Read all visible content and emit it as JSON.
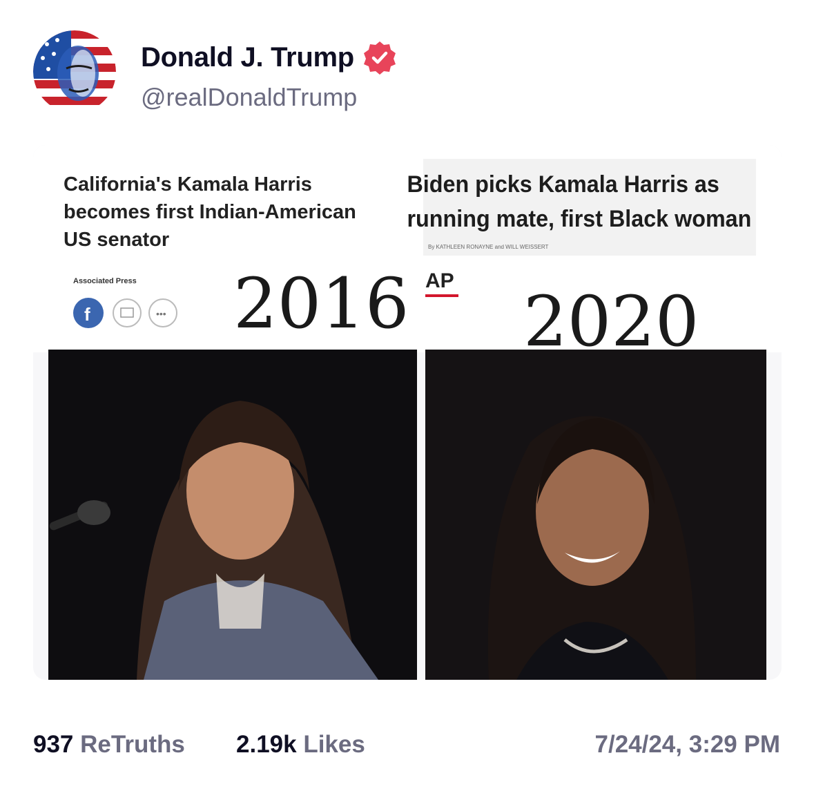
{
  "post": {
    "author": {
      "display_name": "Donald J. Trump",
      "handle": "@realDonaldTrump",
      "verified": true,
      "avatar_icon": "avatar-flag-portrait"
    },
    "image": {
      "left_headline": [
        "California's Kamala Harris",
        "becomes first Indian-American",
        "US senator"
      ],
      "left_source": "Associated Press",
      "right_headline": [
        "Biden picks Kamala Harris as",
        "running mate, first Black woman"
      ],
      "right_byline": "By KATHLEEN RONAYNE and WILL WEISSERT",
      "ap_logo": "AP",
      "year_left": "2016",
      "year_right": "2020"
    },
    "stats": {
      "retruths_count": "937",
      "retruths_label": "ReTruths",
      "likes_count": "2.19k",
      "likes_label": "Likes",
      "timestamp": "7/24/24, 3:29 PM"
    }
  },
  "colors": {
    "verified_badge": "#e8445a",
    "muted_text": "#6b6b80",
    "primary_text": "#0f0f23"
  }
}
